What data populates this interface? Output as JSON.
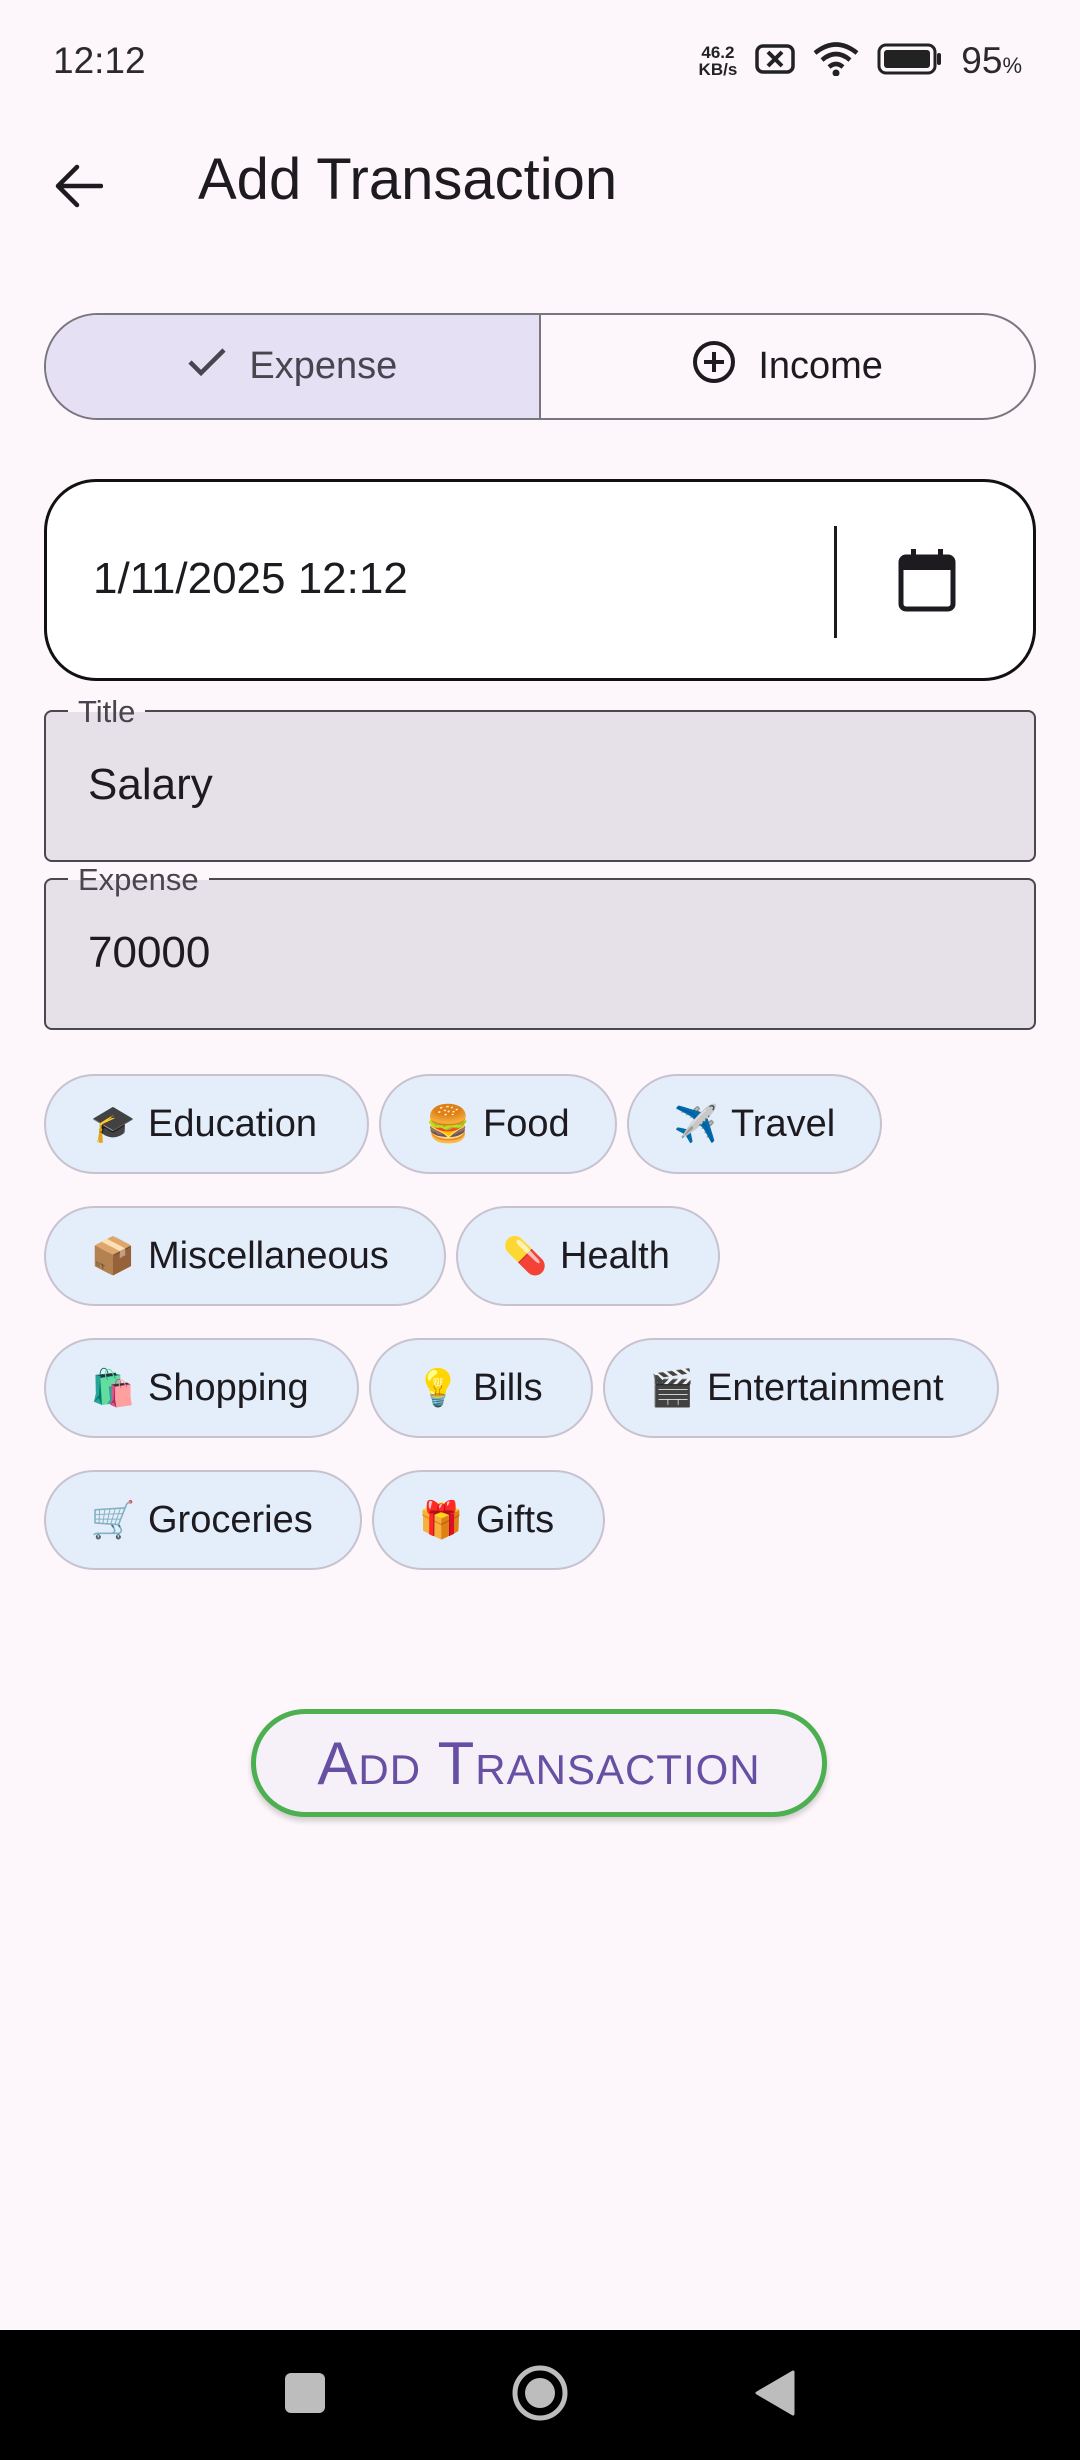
{
  "status_bar": {
    "time": "12:12",
    "net_speed_value": "46.2",
    "net_speed_unit": "KB/s",
    "battery_percent": "95",
    "battery_percent_sign": "%",
    "icons": [
      "sim-x-icon",
      "wifi-icon",
      "battery-icon"
    ]
  },
  "app_bar": {
    "title": "Add Transaction",
    "back_icon": "arrow-back-icon"
  },
  "type_toggle": {
    "options": [
      {
        "label": "Expense",
        "icon": "check-icon",
        "selected": true
      },
      {
        "label": "Income",
        "icon": "add-circle-icon",
        "selected": false
      }
    ]
  },
  "date_field": {
    "value": "1/11/2025 12:12",
    "icon": "calendar-icon"
  },
  "title_field": {
    "label": "Title",
    "value": "Salary"
  },
  "amount_field": {
    "label": "Expense",
    "value": "70000"
  },
  "categories": [
    {
      "emoji": "🎓",
      "label": "Education"
    },
    {
      "emoji": "🍔",
      "label": "Food"
    },
    {
      "emoji": "✈️",
      "label": "Travel"
    },
    {
      "emoji": "📦",
      "label": "Miscellaneous"
    },
    {
      "emoji": "💊",
      "label": "Health"
    },
    {
      "emoji": "🛍️",
      "label": "Shopping"
    },
    {
      "emoji": "💡",
      "label": "Bills"
    },
    {
      "emoji": "🎬",
      "label": "Entertainment"
    },
    {
      "emoji": "🛒",
      "label": "Groceries"
    },
    {
      "emoji": "🎁",
      "label": "Gifts"
    }
  ],
  "submit": {
    "label": "Add Transaction"
  },
  "colors": {
    "background": "#FDF7FC",
    "segment_selected": "#E6E0F5",
    "chip_background": "#E3EEFA",
    "submit_border": "#4CAF50",
    "submit_text": "#6750A4"
  }
}
